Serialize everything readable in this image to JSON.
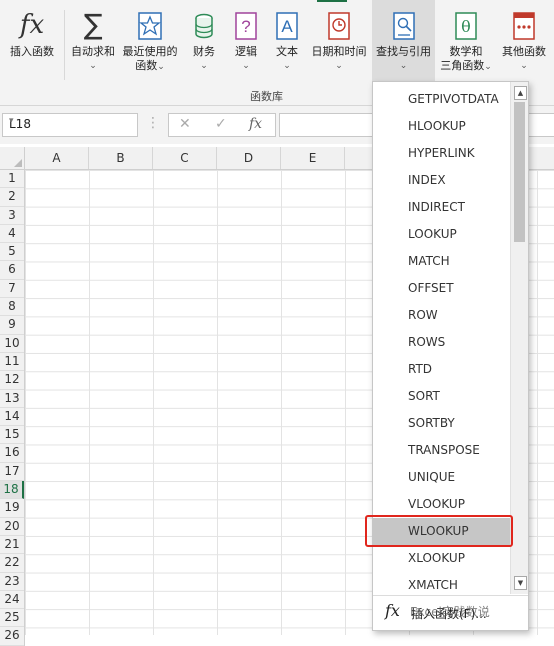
{
  "ribbon": {
    "buttons": [
      {
        "label": "插入函数",
        "label2": "",
        "chev": ""
      },
      {
        "label": "自动求和",
        "label2": "",
        "chev": "⌄"
      },
      {
        "label": "最近使用的",
        "label2": "函数",
        "chev": "⌄"
      },
      {
        "label": "财务",
        "label2": "",
        "chev": "⌄"
      },
      {
        "label": "逻辑",
        "label2": "",
        "chev": "⌄"
      },
      {
        "label": "文本",
        "label2": "",
        "chev": "⌄"
      },
      {
        "label": "日期和时间",
        "label2": "",
        "chev": "⌄"
      },
      {
        "label": "查找与引用",
        "label2": "",
        "chev": "⌄"
      },
      {
        "label": "数学和",
        "label2": "三角函数",
        "chev": "⌄"
      },
      {
        "label": "其他函数",
        "label2": "",
        "chev": "⌄"
      }
    ],
    "group_label": "函数库"
  },
  "formula_bar": {
    "name_box": "L18",
    "fx": "fx",
    "cancel": "✕",
    "enter": "✓",
    "dots": "⋮"
  },
  "sheet": {
    "columns": [
      "A",
      "B",
      "C",
      "D",
      "E"
    ],
    "rows": [
      "1",
      "2",
      "3",
      "4",
      "5",
      "6",
      "7",
      "8",
      "9",
      "10",
      "11",
      "12",
      "13",
      "14",
      "15",
      "16",
      "17",
      "18",
      "19",
      "20",
      "21",
      "22",
      "23",
      "24",
      "25",
      "26"
    ],
    "selected_row": "18"
  },
  "dropdown": {
    "functions": [
      "GETPIVOTDATA",
      "HLOOKUP",
      "HYPERLINK",
      "INDEX",
      "INDIRECT",
      "LOOKUP",
      "MATCH",
      "OFFSET",
      "ROW",
      "ROWS",
      "RTD",
      "SORT",
      "SORTBY",
      "TRANSPOSE",
      "UNIQUE",
      "VLOOKUP",
      "WLOOKUP",
      "XLOOKUP",
      "XMATCH"
    ],
    "highlighted": "WLOOKUP",
    "insert_function_label": "插入函数(F)...",
    "insert_function_icon": "fx"
  },
  "watermark": "Excel实践数说",
  "colors": {
    "accent": "#1e7145",
    "highlight_border": "#e0261d"
  }
}
